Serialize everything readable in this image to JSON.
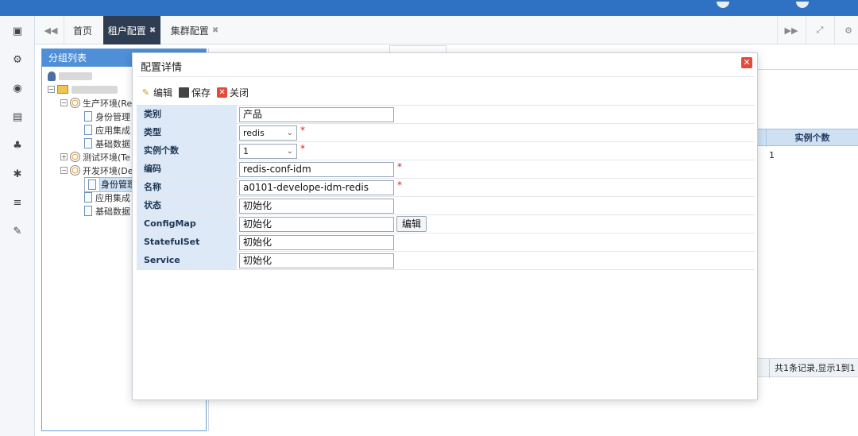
{
  "tabs": {
    "home": "首页",
    "tenant_config": "租户配置",
    "cluster_config": "集群配置",
    "close_glyph": "✖"
  },
  "group_panel": {
    "title": "分组列表",
    "tree": [
      {
        "label": "生产环境(Re",
        "kind": "env"
      },
      {
        "label": "身份管理",
        "kind": "doc"
      },
      {
        "label": "应用集成",
        "kind": "doc"
      },
      {
        "label": "基础数据",
        "kind": "doc"
      },
      {
        "label": "测试环境(Te",
        "kind": "env"
      },
      {
        "label": "开发环境(De",
        "kind": "env"
      },
      {
        "label": "身份管理",
        "kind": "doc",
        "selected": true
      },
      {
        "label": "应用集成",
        "kind": "doc"
      },
      {
        "label": "基础数据",
        "kind": "doc"
      }
    ]
  },
  "grid": {
    "header": "实例个数",
    "cell": "1",
    "pager": "共1条记录,显示1到1"
  },
  "dialog": {
    "title": "配置详情",
    "toolbar": {
      "edit": "编辑",
      "save": "保存",
      "close": "关闭"
    },
    "fields": {
      "category_label": "类别",
      "category_value": "产品",
      "type_label": "类型",
      "type_value": "redis",
      "instances_label": "实例个数",
      "instances_value": "1",
      "code_label": "编码",
      "code_value": "redis-conf-idm",
      "name_label": "名称",
      "name_value": "a0101-develope-idm-redis",
      "status_label": "状态",
      "status_value": "初始化",
      "configmap_label": "ConfigMap",
      "configmap_value": "初始化",
      "configmap_button": "编辑",
      "statefulset_label": "StatefulSet",
      "statefulset_value": "初始化",
      "service_label": "Service",
      "service_value": "初始化"
    },
    "required_mark": "*"
  },
  "colors": {
    "topbar": "#2f72c4",
    "active_tab": "#2e3d52",
    "panel_head": "#4f8fd8",
    "label_bg": "#dde9f7",
    "required": "#e02020",
    "close": "#e24a3b"
  }
}
